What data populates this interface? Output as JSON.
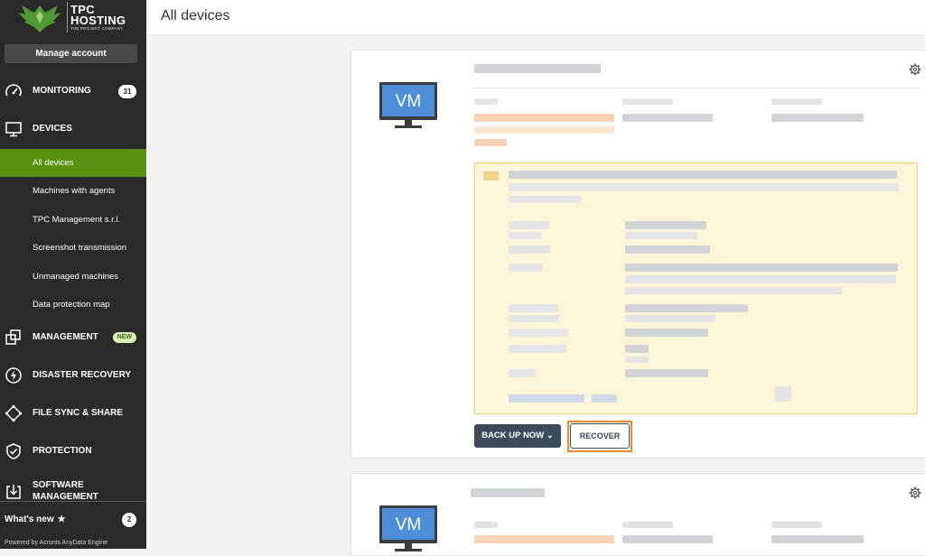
{
  "brand": {
    "name_line1": "TPC",
    "name_line2": "HOSTING",
    "tagline": "THE PROJEKT COMPANY",
    "accent_color": "#58910f"
  },
  "sidebar": {
    "manage_account": "Manage account",
    "sections": [
      {
        "label": "MONITORING",
        "icon": "speedometer-icon",
        "badge": "31"
      },
      {
        "label": "DEVICES",
        "icon": "monitor-icon"
      },
      {
        "label": "MANAGEMENT",
        "icon": "copy-stack-icon",
        "badge": "NEW"
      },
      {
        "label": "DISASTER RECOVERY",
        "icon": "lightning-icon"
      },
      {
        "label": "FILE SYNC & SHARE",
        "icon": "share-nodes-icon"
      },
      {
        "label": "PROTECTION",
        "icon": "shield-check-icon"
      },
      {
        "label": "SOFTWARE",
        "label2": "MANAGEMENT",
        "icon": "download-box-icon"
      }
    ],
    "device_items": [
      {
        "label": "All devices",
        "active": true
      },
      {
        "label": "Machines with agents"
      },
      {
        "label": "TPC Management s.r.l."
      },
      {
        "label": "Screenshot transmission"
      },
      {
        "label": "Unmanaged machines"
      },
      {
        "label": "Data protection map"
      }
    ],
    "whats_new": "What's new",
    "whats_new_count": "2",
    "powered_by": "Powered by Acronis AnyData Engine"
  },
  "header": {
    "title": "All devices"
  },
  "devices": [
    {
      "vm_label": "VM",
      "backup_button": "BACK UP NOW",
      "recover_button": "RECOVER"
    },
    {
      "vm_label": "VM"
    }
  ]
}
